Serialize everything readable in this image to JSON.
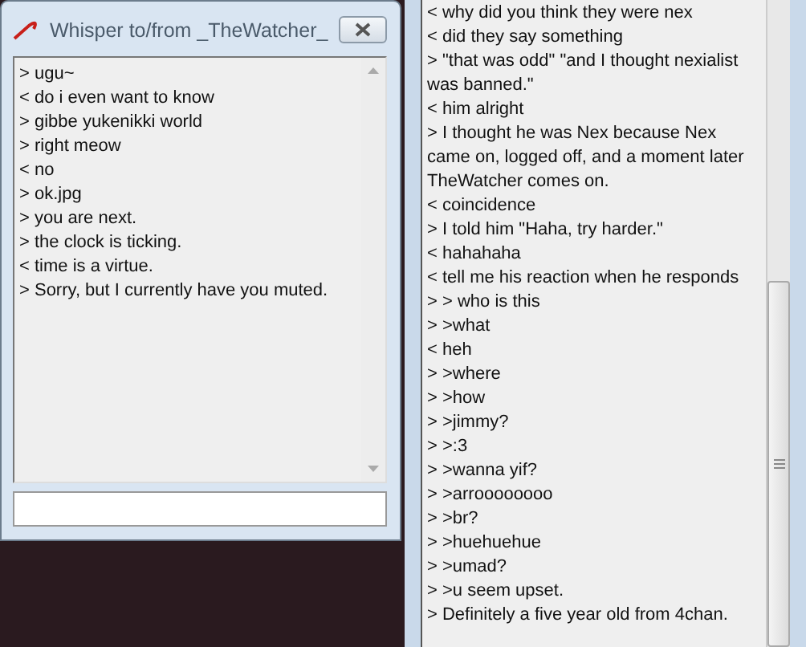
{
  "whisper_window": {
    "title": "Whisper to/from _TheWatcher_",
    "messages": [
      "> ugu~",
      "< do i even want to know",
      "> gibbe yukenikki world",
      "> right meow",
      "< no",
      "> ok.jpg",
      "> you are next.",
      "> the clock is ticking.",
      "< time is a virtue.",
      "> Sorry, but I currently have you muted."
    ]
  },
  "chat_window": {
    "messages": [
      "< why did you think they were nex",
      "< did they say something",
      "> \"that was odd\" \"and I thought nexialist was banned.\"",
      "< him alright",
      "> I thought he was Nex because Nex came on, logged off, and a moment later TheWatcher comes on.",
      "< coincidence",
      "> I told him \"Haha, try harder.\"",
      "< hahahaha",
      "< tell me his reaction when he responds",
      "> > who is this",
      "> >what",
      "< heh",
      "> >where",
      "> >how",
      "> >jimmy?",
      "> >:3",
      "> >wanna yif?",
      "> >arroooooooo",
      "> >br?",
      "> >huehuehue",
      "> >umad?",
      "> >u seem upset.",
      "> Definitely a five year old from 4chan."
    ]
  }
}
